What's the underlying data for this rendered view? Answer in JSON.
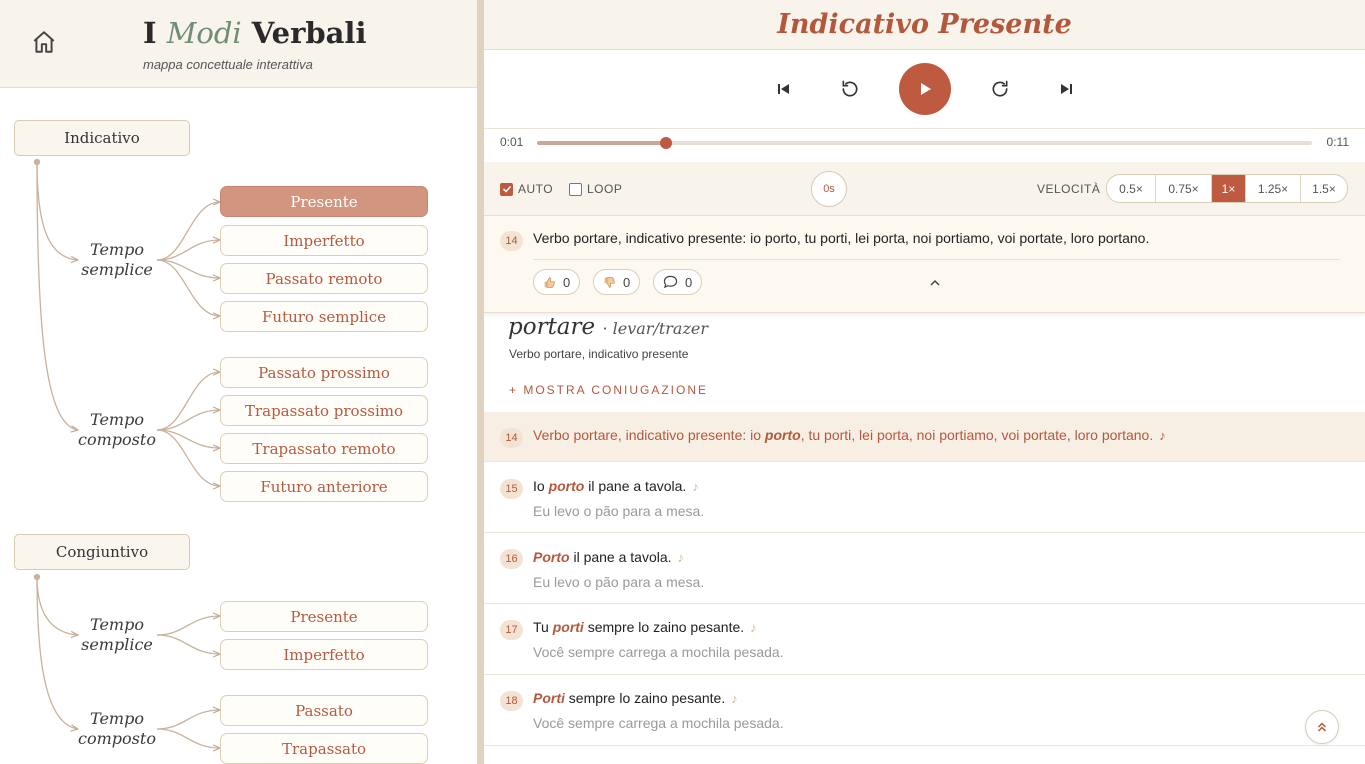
{
  "app": {
    "title_pre": "I",
    "title_mid": "Modi",
    "title_post": "Verbali",
    "subtitle": "mappa concettuale interattiva"
  },
  "icons": {
    "home": "home-icon",
    "prev": "skip-previous-icon",
    "rewind": "replay-icon",
    "play": "play-icon",
    "forward": "forward-icon",
    "next": "skip-next-icon",
    "like": "thumbs-up-icon",
    "dislike": "thumbs-down-icon",
    "comment": "comment-icon",
    "collapse": "chevron-up-icon",
    "scroll": "double-chevron-up-icon"
  },
  "colors": {
    "accent": "#bd5a3f",
    "active_tense": "#d19580",
    "header_bg": "#f8f4ec"
  },
  "tree": {
    "indicativo": {
      "label": "Indicativo",
      "semplice_label": {
        "l1": "Tempo",
        "l2": "semplice"
      },
      "semplice": [
        "Presente",
        "Imperfetto",
        "Passato remoto",
        "Futuro semplice"
      ],
      "composto_label": {
        "l1": "Tempo",
        "l2": "composto"
      },
      "composto": [
        "Passato prossimo",
        "Trapassato prossimo",
        "Trapassato remoto",
        "Futuro anteriore"
      ]
    },
    "congiuntivo": {
      "label": "Congiuntivo",
      "semplice_label": {
        "l1": "Tempo",
        "l2": "semplice"
      },
      "semplice": [
        "Presente",
        "Imperfetto"
      ],
      "composto_label": {
        "l1": "Tempo",
        "l2": "composto"
      },
      "composto": [
        "Passato",
        "Trapassato"
      ]
    },
    "active": "Indicativo Presente"
  },
  "page": {
    "title": "Indicativo Presente"
  },
  "player": {
    "current_time": "0:01",
    "total_time": "0:11",
    "progress": 0.167
  },
  "options": {
    "auto_label": "AUTO",
    "auto_checked": true,
    "loop_label": "LOOP",
    "loop_checked": false,
    "timer": "0s",
    "speed_label": "VELOCITÀ",
    "speeds": [
      "0.5×",
      "0.75×",
      "1×",
      "1.25×",
      "1.5×"
    ],
    "speed_active": "1×"
  },
  "current": {
    "number": "14",
    "text": "Verbo portare, indicativo presente: io porto, tu porti, lei porta, noi portiamo, voi portate, loro portano.",
    "likes": "0",
    "dislikes": "0",
    "comments": "0"
  },
  "verb": {
    "word": "portare",
    "translation": "· levar/trazer",
    "description": "Verbo portare, indicativo presente",
    "show_conjugation": "+ MOSTRA CONIUGAZIONE"
  },
  "sentences": [
    {
      "n": "14",
      "pre": "Verbo portare, indicativo presente: io ",
      "hl": "porto",
      "post": ", tu porti, lei porta, noi portiamo, voi portate, loro portano.",
      "note": "♪",
      "pt": "",
      "active": true
    },
    {
      "n": "15",
      "pre": "Io ",
      "hl": "porto",
      "post": " il pane a tavola.",
      "note": "♪",
      "pt": "Eu levo o pão para a mesa."
    },
    {
      "n": "16",
      "pre": "",
      "hl": "Porto",
      "post": " il pane a tavola.",
      "note": "♪",
      "pt": "Eu levo o pão para a mesa."
    },
    {
      "n": "17",
      "pre": "Tu ",
      "hl": "porti",
      "post": " sempre lo zaino pesante.",
      "note": "♪",
      "pt": "Você sempre carrega a mochila pesada."
    },
    {
      "n": "18",
      "pre": "",
      "hl": "Porti",
      "post": " sempre lo zaino pesante.",
      "note": "♪",
      "pt": "Você sempre carrega a mochila pesada."
    }
  ]
}
